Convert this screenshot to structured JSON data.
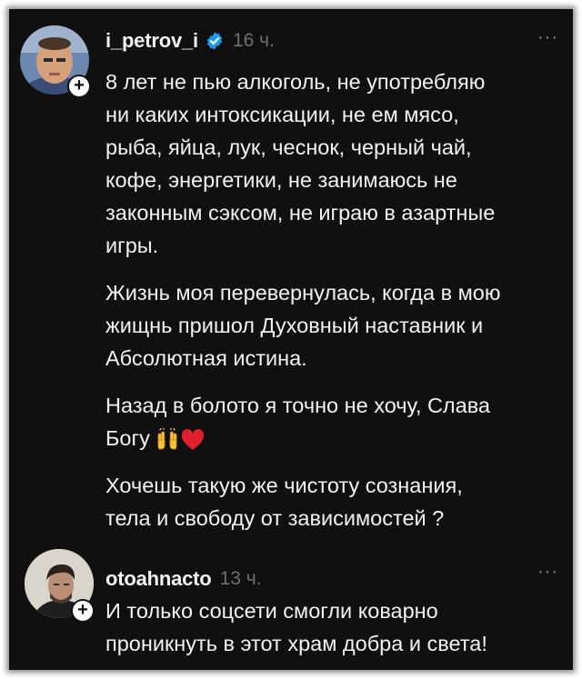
{
  "comments": [
    {
      "username": "i_petrov_i",
      "time": "16 ч.",
      "more": "···",
      "paragraphs": [
        "8 лет не пью алкоголь,  не употребляю\nни каких интоксикации, не ем мясо,\nрыба, яйца, лук, чеснок, черный чай,\nкофе, энергетики, не занимаюсь не\nзаконным сэксом, не играю в азартные\nигры.",
        "Жизнь моя перевернулась, когда в мою\nжищнь пришол Духовный наставник и\nАбсолютная истина.",
        "Назад в болото я точно не хочу, Слава\nБогу",
        "Хочешь такую же чистоту сознания,\nтела и свободу от зависимостей ?"
      ],
      "emojis": [
        "raised-hands",
        "red-heart"
      ]
    },
    {
      "username": "otoahnacto",
      "time": "13 ч.",
      "more": "···",
      "paragraphs": [
        "И только соцсети смогли коварно\nпроникнуть в этот храм добра и света!"
      ]
    }
  ],
  "icons": [
    "verified-badge-icon",
    "follow-plus-icon",
    "more-options-icon"
  ],
  "colors": {
    "background": "#101010",
    "text": "#f2f2f2",
    "muted": "#6f6f6f",
    "verified": "#1d9bf0",
    "heart": "#e0202e"
  }
}
